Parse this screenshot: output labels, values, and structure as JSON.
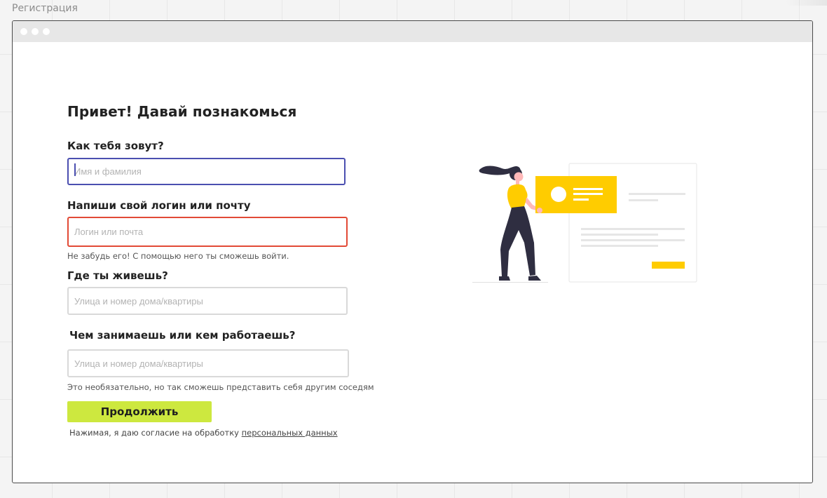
{
  "canvas_label": "Регистрация",
  "form": {
    "title": "Привет! Давай познакомься",
    "name": {
      "label": "Как тебя зовут?",
      "placeholder": "Имя и фамилия"
    },
    "login": {
      "label": "Напиши свой логин или почту",
      "placeholder": "Логин или почта",
      "hint": "Не забудь его! С помощью него ты сможешь войти."
    },
    "address": {
      "label": "Где ты живешь?",
      "placeholder": "Улица и номер дома/квартиры"
    },
    "occupation": {
      "label": "Чем занимаешь или кем работаешь?",
      "placeholder": "Улица и номер дома/квартиры",
      "hint": "Это необязательно, но так сможешь представить себя другим соседям"
    },
    "submit_label": "Продолжить",
    "consent_text": "Нажимая, я даю согласие на обработку ",
    "consent_link": "персональных данных"
  },
  "colors": {
    "focus_border": "#4b4fb0",
    "error_border": "#e24a36",
    "button_bg": "#cde83f",
    "illustration_accent": "#ffcc00"
  },
  "icons": {
    "window_controls": "window-dots-icon",
    "illustration": "woman-holding-profile-card-illustration"
  }
}
